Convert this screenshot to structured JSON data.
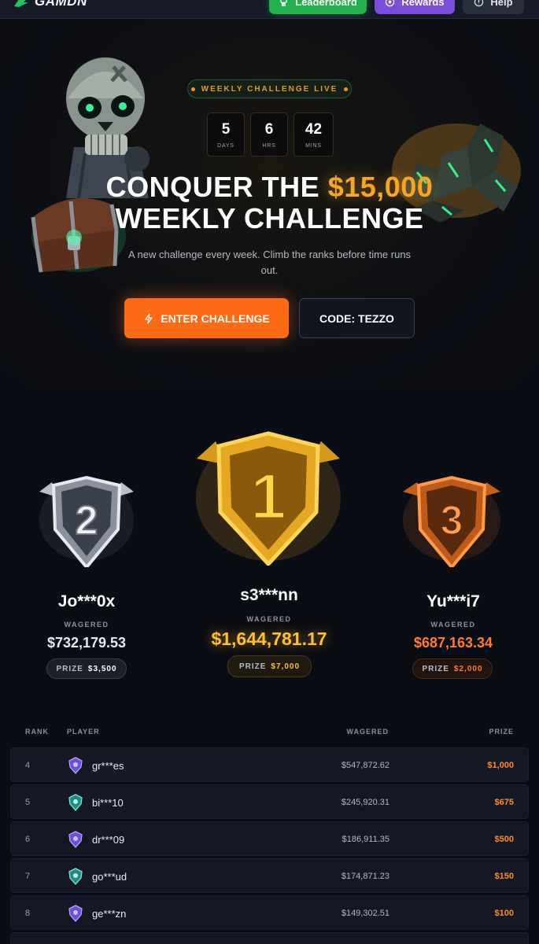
{
  "brand": {
    "name": "GAMDN"
  },
  "nav": {
    "leaderboard": "Leaderboard",
    "rewards": "Rewards",
    "help": "Help"
  },
  "hero": {
    "live_label": "WEEKLY CHALLENGE LIVE",
    "countdown": [
      {
        "value": "5",
        "unit": "DAYS"
      },
      {
        "value": "6",
        "unit": "HRS"
      },
      {
        "value": "42",
        "unit": "MINS"
      }
    ],
    "title_prefix": "CONQUER THE",
    "title_amount": "$15,000",
    "title_suffix": "WEEKLY CHALLENGE",
    "subtitle": "A new challenge every week. Climb the ranks before time runs out.",
    "enter_button": "ENTER CHALLENGE",
    "code_button": "CODE: TEZZO"
  },
  "podium": {
    "wagered_label": "WAGERED",
    "prize_label": "PRIZE",
    "first": {
      "rank": "1",
      "name": "s3***nn",
      "wagered": "$1,644,781.17",
      "prize": "$7,000"
    },
    "second": {
      "rank": "2",
      "name": "Jo***0x",
      "wagered": "$732,179.53",
      "prize": "$3,500"
    },
    "third": {
      "rank": "3",
      "name": "Yu***i7",
      "wagered": "$687,163.34",
      "prize": "$2,000"
    }
  },
  "table": {
    "headers": {
      "rank": "RANK",
      "player": "PLAYER",
      "wagered": "WAGERED",
      "prize": "PRIZE"
    },
    "rows": [
      {
        "rank": "4",
        "player": "gr***es",
        "wagered": "$547,872.62",
        "prize": "$1,000",
        "badge": "purple-badge-icon"
      },
      {
        "rank": "5",
        "player": "bi***10",
        "wagered": "$245,920.31",
        "prize": "$675",
        "badge": "teal-badge-icon"
      },
      {
        "rank": "6",
        "player": "dr***09",
        "wagered": "$186,911.35",
        "prize": "$500",
        "badge": "purple-badge-icon"
      },
      {
        "rank": "7",
        "player": "go***ud",
        "wagered": "$174,871.23",
        "prize": "$150",
        "badge": "teal-badge-icon"
      },
      {
        "rank": "8",
        "player": "ge***zn",
        "wagered": "$149,302.51",
        "prize": "$100",
        "badge": "purple-badge-icon"
      }
    ]
  },
  "colors": {
    "accent_orange": "#ff6a14",
    "gold": "#f5a623",
    "silver": "#e6e9ef",
    "bronze": "#ff7a2a",
    "green": "#22b14c",
    "purple": "#7c4ddc"
  }
}
